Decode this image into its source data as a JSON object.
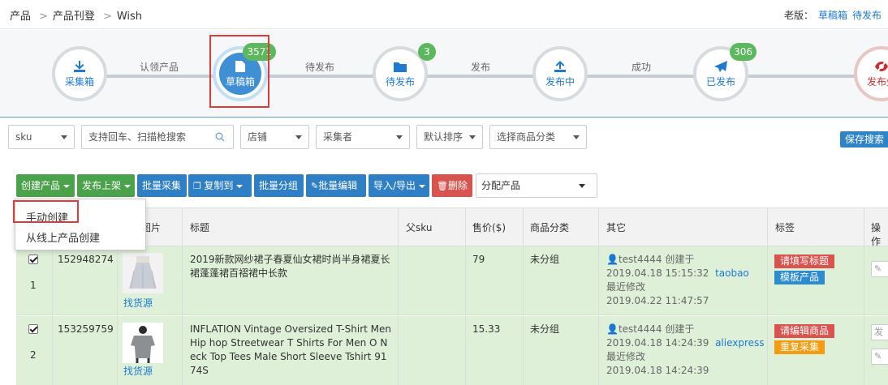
{
  "breadcrumb": {
    "items": [
      "产品",
      "产品刊登",
      "Wish"
    ]
  },
  "oldver": {
    "label": "老版：",
    "links": [
      "草稿箱",
      "待发布"
    ]
  },
  "flow": {
    "nodes": [
      {
        "label": "采集箱",
        "badge": ""
      },
      {
        "label": "草稿箱",
        "badge": "3571"
      },
      {
        "label": "待发布",
        "badge": "3"
      },
      {
        "label": "发布中",
        "badge": ""
      },
      {
        "label": "已发布",
        "badge": "306"
      },
      {
        "label": "发布失",
        "badge": ""
      }
    ],
    "steps": [
      "认领产品",
      "待发布",
      "发布",
      "成功"
    ],
    "colors": {
      "active": "#3e8fd3",
      "badge": "#5cb85c",
      "highlight": "#e03b3b"
    }
  },
  "filters": {
    "sku": "sku",
    "search_placeholder": "支持回车、扫描枪搜索",
    "shop": "店铺",
    "collector": "采集者",
    "sort": "默认排序",
    "category": "选择商品分类",
    "save": "保存搜索"
  },
  "toolbar": {
    "create": "创建产品",
    "publish": "发布上架",
    "batch_collect": "批量采集",
    "copy": "复制到",
    "batch_group": "批量分组",
    "batch_edit": "批量编辑",
    "import_export": "导入/导出",
    "delete": "删除",
    "assign": "分配产品"
  },
  "create_menu": [
    "手动创建",
    "从线上产品创建"
  ],
  "table": {
    "headers": [
      "图片",
      "标题",
      "父sku",
      "售价($)",
      "商品分类",
      "其它",
      "标签",
      "操作"
    ],
    "rows": [
      {
        "index": "1",
        "id": "152948274",
        "find": "找货源",
        "title": "2019新款网纱裙子春夏仙女裙时尚半身裙夏长裙蓬蓬裙百褶裙中长款",
        "price": "79",
        "category": "未分组",
        "creator": "test4444 创建于",
        "created": "2019.04.18 15:15:32",
        "source": "taobao",
        "modified_label": "最近修改",
        "modified": "2019.04.22 11:47:57",
        "tags": [
          "请填写标题",
          "模板产品"
        ]
      },
      {
        "index": "2",
        "id": "153259759",
        "find": "找货源",
        "title": "INFLATION Vintage Oversized T-Shirt Men Hip hop Streetwear T Shirts For Men O Neck Top Tees Male Short Sleeve Tshirt 9174S",
        "price": "15.33",
        "category": "未分组",
        "creator": "test4444 创建于",
        "created": "2019.04.18 14:24:39",
        "source": "aliexpress",
        "modified_label": "最近修改",
        "modified": "2019.04.18 14:24:39",
        "tags": [
          "请编辑商品",
          "重复采集"
        ],
        "op": "发"
      }
    ]
  }
}
